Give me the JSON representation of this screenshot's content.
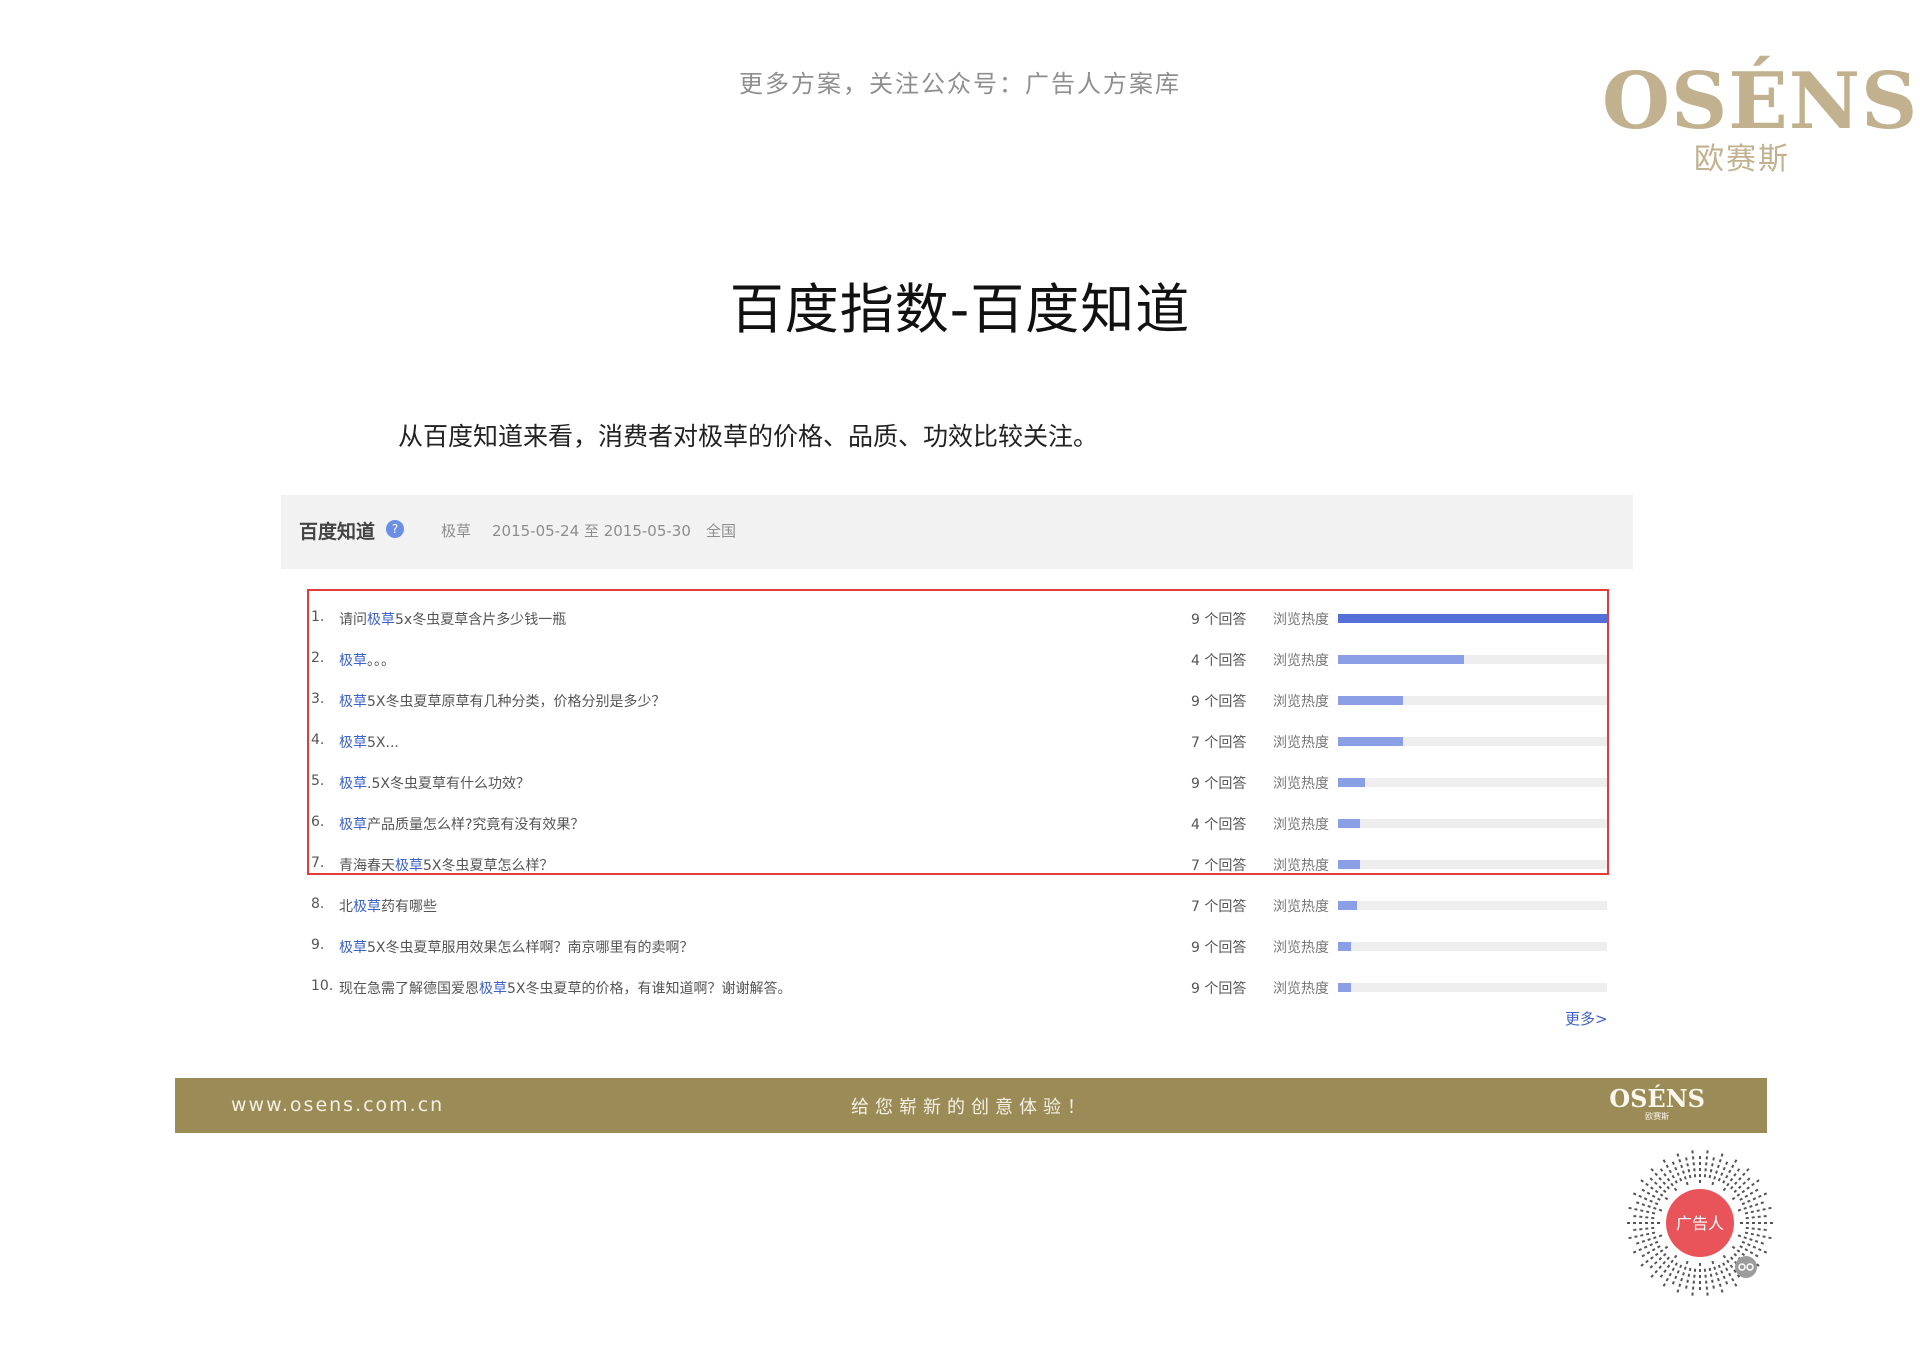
{
  "top_note": "更多方案，关注公众号：广告人方案库",
  "logo": {
    "word": "OSÉNS",
    "reg": "®",
    "cn": "欧赛斯"
  },
  "slide": {
    "title": "百度指数-百度知道",
    "subtitle": "从百度知道来看，消费者对极草的价格、品质、功效比较关注。"
  },
  "zhidao": {
    "brand": "百度知道",
    "help_icon": "question-circle-icon",
    "keyword": "极草",
    "date_range": "2015-05-24 至 2015-05-30",
    "region": "全国",
    "heat_label": "浏览热度",
    "more_label": "更多>",
    "rows": [
      {
        "num": "1.",
        "pre": "请问",
        "kw": "极草",
        "post": "5x冬虫夏草含片多少钱一瓶",
        "answers": "9 个回答",
        "heat": 1.0
      },
      {
        "num": "2.",
        "pre": "",
        "kw": "极草",
        "post": "。。。",
        "answers": "4 个回答",
        "heat": 0.47
      },
      {
        "num": "3.",
        "pre": "",
        "kw": "极草",
        "post": "5X冬虫夏草原草有几种分类，价格分别是多少？",
        "answers": "9 个回答",
        "heat": 0.24
      },
      {
        "num": "4.",
        "pre": "",
        "kw": "极草",
        "post": "5X...",
        "answers": "7 个回答",
        "heat": 0.24
      },
      {
        "num": "5.",
        "pre": "",
        "kw": "极草",
        "post": ".5X冬虫夏草有什么功效？",
        "answers": "9 个回答",
        "heat": 0.1
      },
      {
        "num": "6.",
        "pre": "",
        "kw": "极草",
        "post": "产品质量怎么样?究竟有没有效果？",
        "answers": "4 个回答",
        "heat": 0.08
      },
      {
        "num": "7.",
        "pre": "青海春天",
        "kw": "极草",
        "post": "5X冬虫夏草怎么样？",
        "answers": "7 个回答",
        "heat": 0.08
      },
      {
        "num": "8.",
        "pre": "北",
        "kw": "极草",
        "post": "药有哪些",
        "answers": "7 个回答",
        "heat": 0.07
      },
      {
        "num": "9.",
        "pre": "",
        "kw": "极草",
        "post": "5X冬虫夏草服用效果怎么样啊？南京哪里有的卖啊？",
        "answers": "9 个回答",
        "heat": 0.05
      },
      {
        "num": "10.",
        "pre": "现在急需了解德国爱恩",
        "kw": "极草",
        "post": "5X冬虫夏草的价格，有谁知道啊？谢谢解答。",
        "answers": "9 个回答",
        "heat": 0.05
      }
    ],
    "colors": {
      "bar_top": "#5470d6",
      "bar": "#8a9fe5",
      "highlight": "#e43c3c"
    }
  },
  "footer": {
    "url": "www.osens.com.cn",
    "slogan": "给您崭新的创意体验！",
    "logo_word": "OSÉNS",
    "logo_cn": "欧赛斯",
    "band_color": "#9a8b57"
  },
  "qr": {
    "badge": "广告人"
  }
}
